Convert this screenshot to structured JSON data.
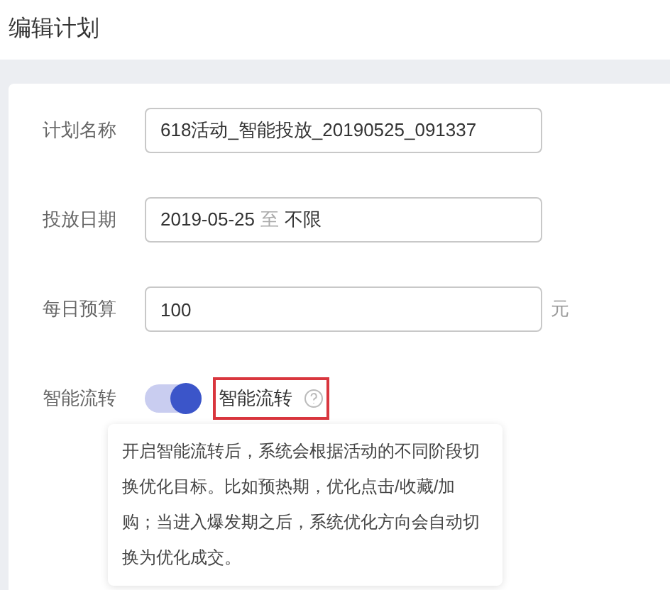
{
  "page_title": "编辑计划",
  "fields": [
    {
      "kind": "text",
      "label": "计划名称",
      "value": "618活动_智能投放_20190525_091337"
    },
    {
      "kind": "date",
      "label": "投放日期",
      "start": "2019-05-25",
      "separator": "至",
      "end": "不限"
    },
    {
      "kind": "money",
      "label": "每日预算",
      "value": "100",
      "unit": "元"
    }
  ],
  "smart_flow": {
    "label": "智能流转",
    "on": true,
    "switch_label": "智能流转",
    "highlighted": true,
    "tooltip": "开启智能流转后，系统会根据活动的不同阶段切换优化目标。比如预热期，优化点击/收藏/加购；当进入爆发期之后，系统优化方向会自动切换为优化成交。"
  }
}
